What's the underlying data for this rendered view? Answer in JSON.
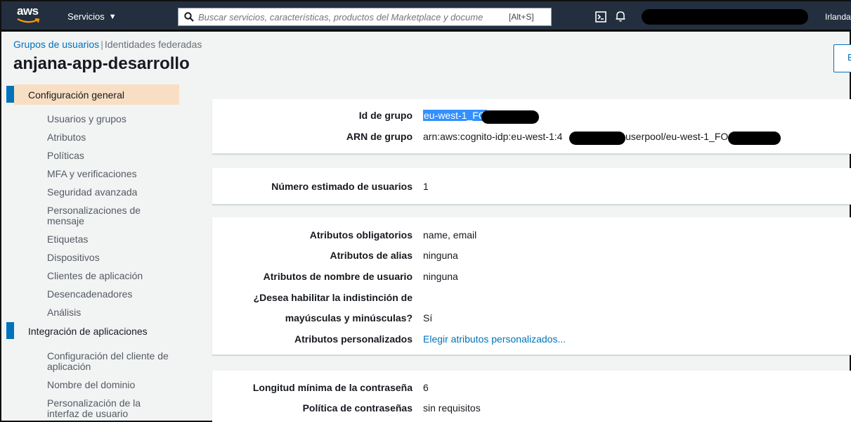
{
  "topbar": {
    "logo": "aws",
    "services": "Servicios",
    "search_placeholder": "Buscar servicios, características, productos del Marketplace y docume",
    "search_shortcut": "[Alt+S]",
    "region": "Irlanda"
  },
  "header": {
    "breadcrumb_link": "Grupos de usuarios",
    "breadcrumb_sep": "|",
    "breadcrumb_current": "Identidades federadas",
    "title": "anjana-app-desarrollo",
    "edge_button": "E"
  },
  "sidebar": {
    "sections": [
      {
        "label": "Configuración general",
        "items": [
          "Usuarios y grupos",
          "Atributos",
          "Políticas",
          "MFA y verificaciones",
          "Seguridad avanzada",
          "Personalizaciones de mensaje",
          "Etiquetas",
          "Dispositivos",
          "Clientes de aplicación",
          "Desencadenadores",
          "Análisis"
        ]
      },
      {
        "label": "Integración de aplicaciones",
        "items": [
          "Configuración del cliente de aplicación",
          "Nombre del dominio",
          "Personalización de la interfaz de usuario"
        ]
      }
    ]
  },
  "group": {
    "id_label": "Id de grupo",
    "id_value": "eu-west-1_FO",
    "arn_label": "ARN de grupo",
    "arn_value_start": "arn:aws:cognito-idp:eu-west-1:4",
    "arn_value_mid": "userpool/eu-west-1_FO"
  },
  "users": {
    "label": "Número estimado de usuarios",
    "value": "1"
  },
  "attributes": {
    "required_label": "Atributos obligatorios",
    "required_value": "name, email",
    "alias_label": "Atributos de alias",
    "alias_value": "ninguna",
    "username_label": "Atributos de nombre de usuario",
    "username_value": "ninguna",
    "case_label_1": "¿Desea habilitar la indistinción de",
    "case_label_2": "mayúsculas y minúsculas?",
    "case_value": "Sí",
    "custom_label": "Atributos personalizados",
    "custom_link": "Elegir atributos personalizados..."
  },
  "password": {
    "min_label": "Longitud mínima de la contraseña",
    "min_value": "6",
    "policy_label": "Política de contraseñas",
    "policy_value": "sin requisitos"
  }
}
